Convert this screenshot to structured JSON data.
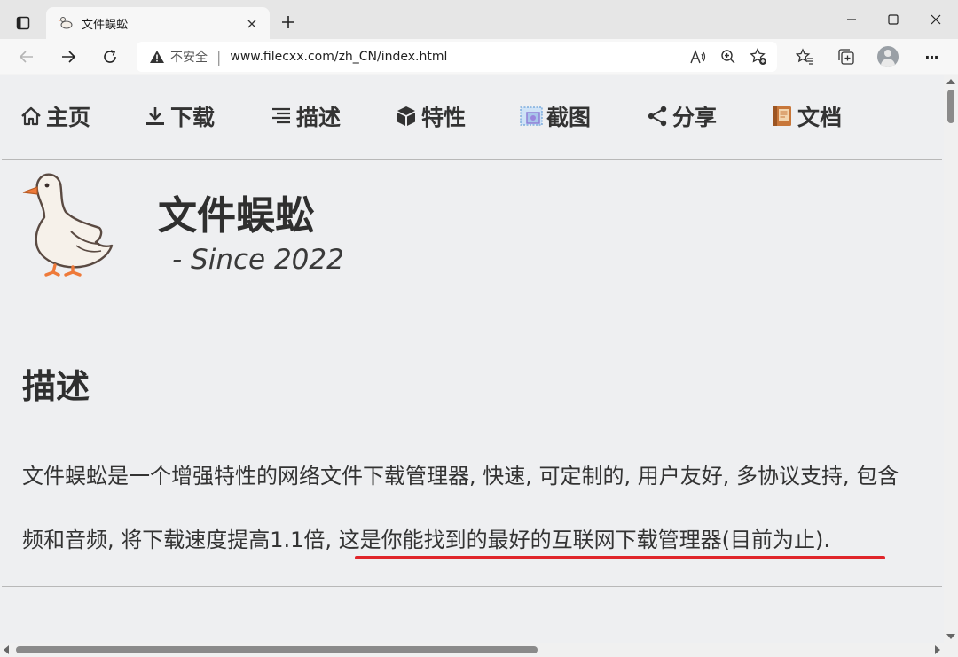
{
  "browser": {
    "tab_title": "文件蜈蚣",
    "tab_close": "×",
    "new_tab": "+",
    "insecure_label": "不安全",
    "separator": "|",
    "url": "www.filecxx.com/zh_CN/index.html",
    "icons": {
      "tab_actions": "tab-actions-icon",
      "back": "back-arrow-icon",
      "forward": "forward-arrow-icon",
      "refresh": "refresh-icon",
      "warning": "warning-icon",
      "read_aloud": "read-aloud-icon",
      "zoom": "zoom-icon",
      "favorite_add": "favorite-add-icon",
      "favorites": "favorites-icon",
      "collections": "collections-icon",
      "profile": "profile-icon",
      "more": "more-icon"
    },
    "more_label": "···"
  },
  "site": {
    "nav": [
      {
        "label": "主页",
        "icon": "home-icon"
      },
      {
        "label": "下载",
        "icon": "download-icon"
      },
      {
        "label": "描述",
        "icon": "description-icon"
      },
      {
        "label": "特性",
        "icon": "cube-icon"
      },
      {
        "label": "截图",
        "icon": "screenshot-icon"
      },
      {
        "label": "分享",
        "icon": "share-icon"
      },
      {
        "label": "文档",
        "icon": "book-icon"
      }
    ],
    "brand": {
      "title": "文件蜈蚣",
      "subtitle": "- Since 2022",
      "logo_icon": "goose-logo-icon"
    },
    "description": {
      "title": "描述",
      "line1": "文件蜈蚣是一个增强特性的网络文件下载管理器, 快速, 可定制的, 用户友好, 多协议支持, 包含",
      "line2_a": "频和音频, 将下载速度提高1.1倍, ",
      "line2_b": "这是你能找到的最好的互联网下载管理器(目前为止)."
    },
    "colors": {
      "underline": "#e0252a",
      "text": "#333333",
      "page_bg": "#eeeff1"
    }
  }
}
